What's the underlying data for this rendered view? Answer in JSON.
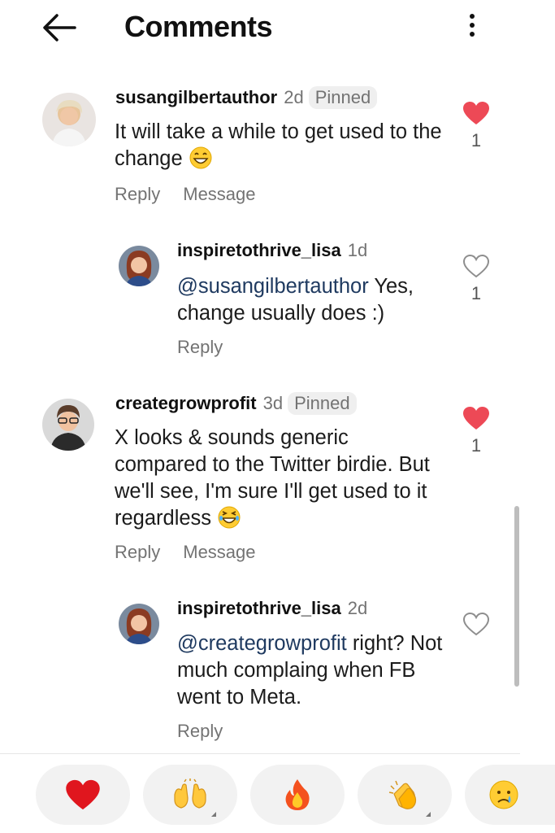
{
  "header": {
    "title": "Comments",
    "back_icon": "arrow-left-icon",
    "menu_icon": "more-vertical-icon"
  },
  "comments": [
    {
      "username": "susangilbertauthor",
      "time": "2d",
      "badge": "Pinned",
      "text": "It will take a while to get used to the change",
      "emoji": "grinning-face",
      "actions": {
        "reply": "Reply",
        "message": "Message"
      },
      "likes": "1",
      "liked": true
    },
    {
      "username": "inspiretothrive_lisa",
      "time": "1d",
      "mention": "@susangilbertauthor",
      "text": " Yes, change usually does :)",
      "actions": {
        "reply": "Reply"
      },
      "likes": "1",
      "liked": false
    },
    {
      "username": "creategrowprofit",
      "time": "3d",
      "badge": "Pinned",
      "text": "X looks & sounds generic compared to the Twitter birdie. But we'll see, I'm sure I'll get used to it regardless",
      "emoji": "laughing-face",
      "actions": {
        "reply": "Reply",
        "message": "Message"
      },
      "likes": "1",
      "liked": true
    },
    {
      "username": "inspiretothrive_lisa",
      "time": "2d",
      "mention": "@creategrowprofit",
      "text": " right? Not much complaing when FB went to Meta.",
      "actions": {
        "reply": "Reply"
      },
      "likes": "",
      "liked": false
    }
  ],
  "reactions": [
    {
      "emoji": "❤️",
      "name": "red-heart"
    },
    {
      "emoji": "🙌",
      "name": "raising-hands"
    },
    {
      "emoji": "🔥",
      "name": "fire"
    },
    {
      "emoji": "👏",
      "name": "clapping-hands"
    },
    {
      "emoji": "😢",
      "name": "crying-face"
    }
  ],
  "colors": {
    "like_red": "#ed4956",
    "muted": "#737373",
    "mention": "#1f3a60",
    "pill_bg": "#f2f2f2"
  }
}
